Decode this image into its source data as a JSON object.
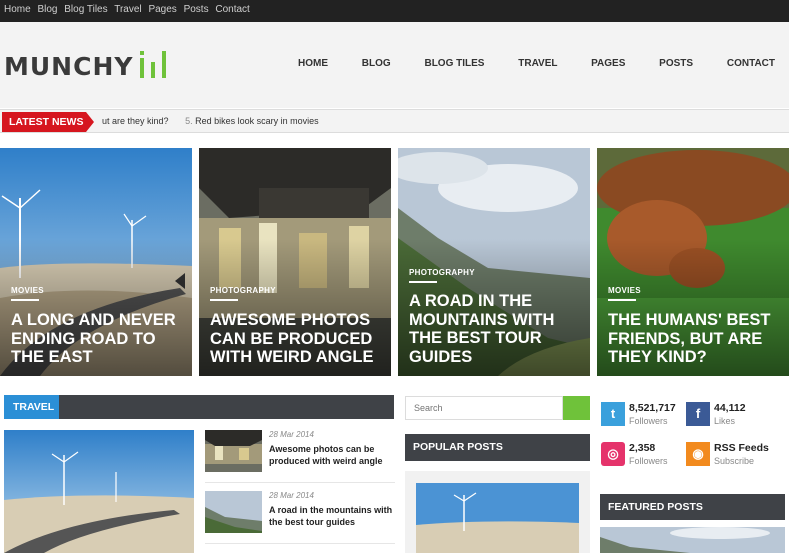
{
  "topbar": {
    "links": [
      "Home",
      "Blog",
      "Blog Tiles",
      "Travel",
      "Pages",
      "Posts",
      "Contact"
    ]
  },
  "header": {
    "logo_text": "MUNCHY",
    "nav": [
      "HOME",
      "BLOG",
      "BLOG TILES",
      "TRAVEL",
      "PAGES",
      "POSTS",
      "CONTACT"
    ]
  },
  "ticker": {
    "label": "LATEST NEWS",
    "item_1": "ut are they kind?",
    "item_2_num": "5.",
    "item_2": "Red bikes look scary in movies"
  },
  "hero": [
    {
      "category": "MOVIES",
      "title": "A LONG AND NEVER ENDING ROAD TO THE EAST"
    },
    {
      "category": "PHOTOGRAPHY",
      "title": "AWESOME PHOTOS CAN BE PRODUCED WITH WEIRD ANGLE"
    },
    {
      "category": "PHOTOGRAPHY",
      "title": "A ROAD IN THE MOUNTAINS WITH THE BEST TOUR GUIDES"
    },
    {
      "category": "MOVIES",
      "title": "THE HUMANS' BEST FRIENDS, BUT ARE THEY KIND?"
    }
  ],
  "travel": {
    "label": "TRAVEL",
    "posts": [
      {
        "date": "28 Mar 2014",
        "title": "Awesome photos can be produced with weird angle"
      },
      {
        "date": "28 Mar 2014",
        "title": "A road in the mountains with the best tour guides"
      }
    ]
  },
  "search": {
    "placeholder": "Search"
  },
  "popular": {
    "label": "POPULAR POSTS"
  },
  "social": [
    {
      "count": "8,521,717",
      "sub": "Followers",
      "color": "#3aa0dc",
      "icon": "twitter-icon"
    },
    {
      "count": "44,112",
      "sub": "Likes",
      "color": "#3b5a96",
      "icon": "facebook-icon"
    },
    {
      "count": "2,358",
      "sub": "Followers",
      "color": "#e5336b",
      "icon": "dribbble-icon"
    },
    {
      "count": "RSS Feeds",
      "sub": "Subscribe",
      "color": "#f28a1e",
      "icon": "rss-icon"
    }
  ],
  "featured": {
    "label": "FEATURED POSTS"
  },
  "colors": {
    "accent_red": "#d6161f",
    "accent_blue": "#2b8fd6",
    "accent_green": "#6fc23a",
    "dark_bar": "#3f4247"
  }
}
